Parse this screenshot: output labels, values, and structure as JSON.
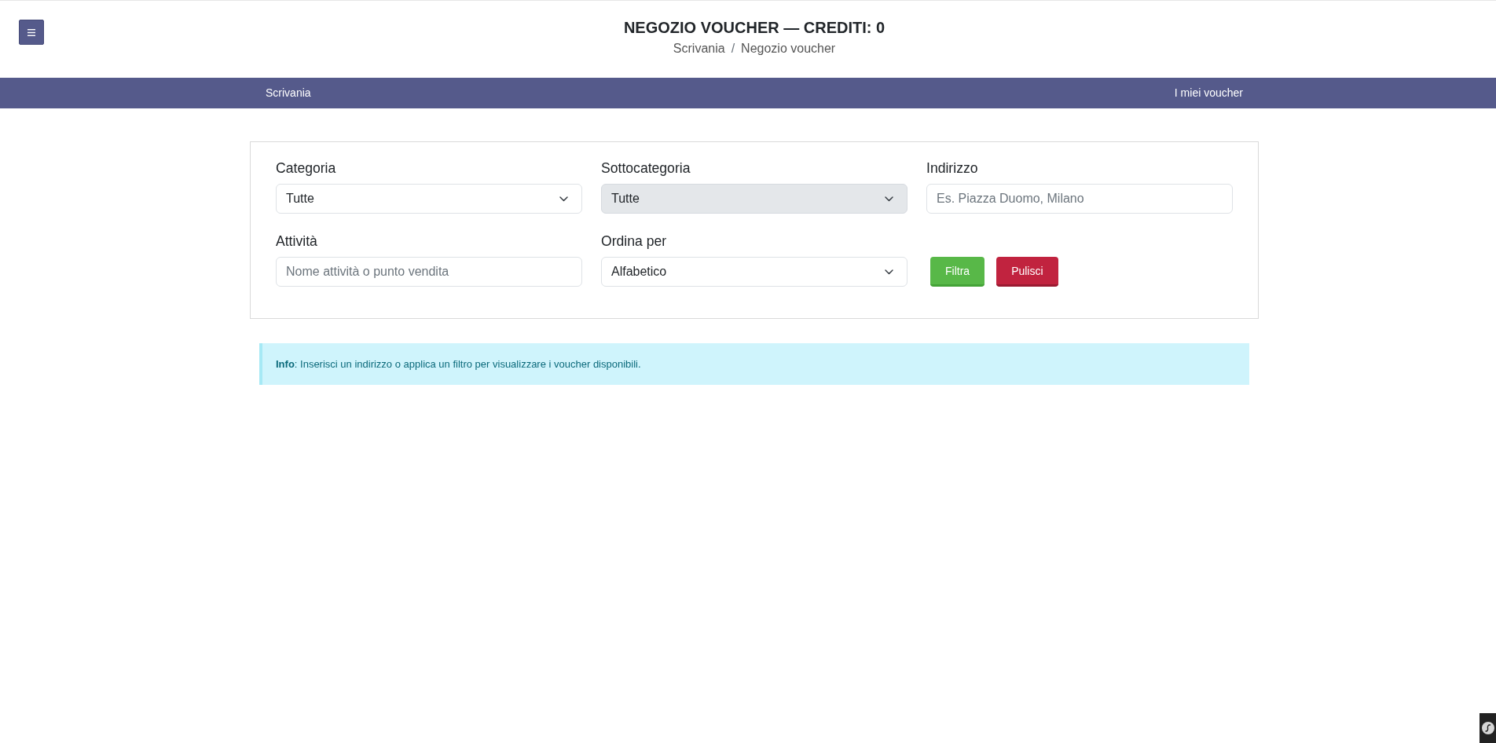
{
  "header": {
    "title": "NEGOZIO VOUCHER — CREDITI: 0",
    "breadcrumb": {
      "items": [
        "Scrivania",
        "Negozio voucher"
      ],
      "separator": "/"
    }
  },
  "navbar": {
    "items": [
      "Scrivania",
      "I miei voucher"
    ]
  },
  "filters": {
    "fields": [
      {
        "label": "Categoria",
        "kind": "select",
        "value": "Tutte",
        "disabled": false
      },
      {
        "label": "Sottocategoria",
        "kind": "select",
        "value": "Tutte",
        "disabled": true
      },
      {
        "label": "Indirizzo",
        "kind": "text",
        "placeholder": "Es. Piazza Duomo, Milano",
        "disabled": false
      },
      {
        "label": "Attività",
        "kind": "text",
        "placeholder": "Nome attività o punto vendita",
        "disabled": false
      },
      {
        "label": "Ordina per",
        "kind": "select",
        "value": "Alfabetico",
        "disabled": false
      }
    ],
    "buttons": [
      {
        "label": "Filtra",
        "kind": "primary"
      },
      {
        "label": "Pulisci",
        "kind": "danger"
      }
    ]
  },
  "alert": {
    "text": "**Info**: Inserisci un indirizzo o applica un filtro per visualizzare i voucher disponibili."
  }
}
